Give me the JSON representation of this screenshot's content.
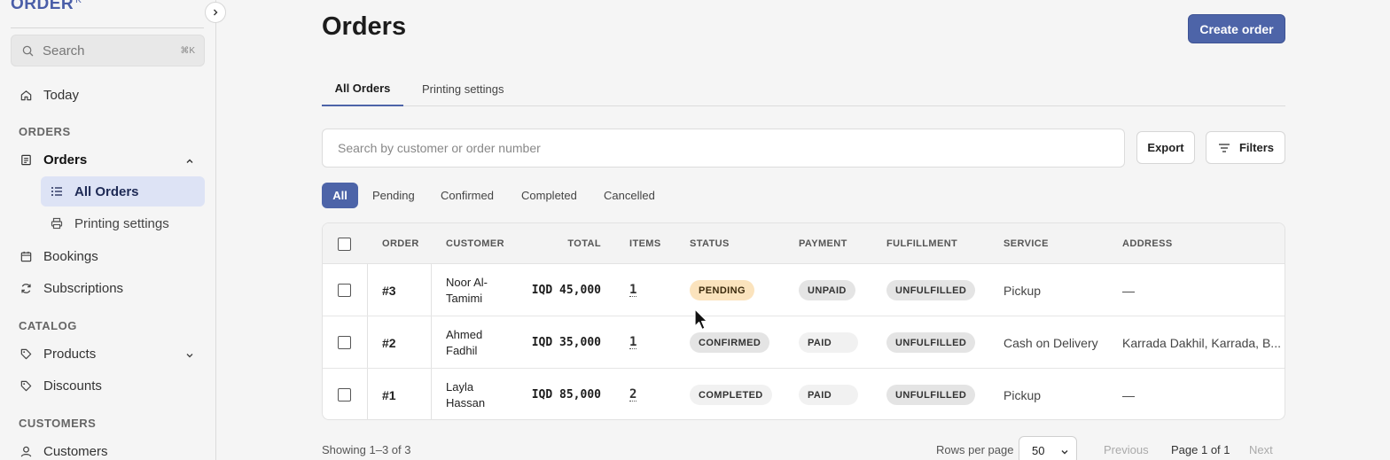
{
  "brand": {
    "logo_text": "ORDER",
    "logo_mark": "K"
  },
  "sidebar": {
    "search": {
      "placeholder": "Search",
      "shortcut": "⌘K"
    },
    "today": "Today",
    "sections": {
      "orders": "ORDERS",
      "catalog": "CATALOG",
      "customers": "CUSTOMERS"
    },
    "orders_label": "Orders",
    "orders_sub": [
      "All Orders",
      "Printing settings"
    ],
    "bookings": "Bookings",
    "subscriptions": "Subscriptions",
    "products": "Products",
    "discounts": "Discounts",
    "customers_item": "Customers"
  },
  "header": {
    "title": "Orders",
    "create_button": "Create order"
  },
  "tabs": [
    "All Orders",
    "Printing settings"
  ],
  "toolbar": {
    "search_placeholder": "Search by customer or order number",
    "export": "Export",
    "filters": "Filters"
  },
  "status_filters": [
    "All",
    "Pending",
    "Confirmed",
    "Completed",
    "Cancelled"
  ],
  "table": {
    "columns": [
      "ORDER",
      "CUSTOMER",
      "TOTAL",
      "ITEMS",
      "STATUS",
      "PAYMENT",
      "FULFILLMENT",
      "SERVICE",
      "ADDRESS"
    ],
    "rows": [
      {
        "order": "#3",
        "customer_line1": "Noor Al-",
        "customer_line2": "Tamimi",
        "total": "IQD 45,000",
        "items": "1",
        "status": "PENDING",
        "payment": "UNPAID",
        "fulfillment": "UNFULFILLED",
        "service": "Pickup",
        "address": "—"
      },
      {
        "order": "#2",
        "customer_line1": "Ahmed",
        "customer_line2": "Fadhil",
        "total": "IQD 35,000",
        "items": "1",
        "status": "CONFIRMED",
        "payment": "PAID",
        "fulfillment": "UNFULFILLED",
        "service": "Cash on Delivery",
        "address": "Karrada Dakhil, Karrada, B..."
      },
      {
        "order": "#1",
        "customer_line1": "Layla",
        "customer_line2": "Hassan",
        "total": "IQD 85,000",
        "items": "2",
        "status": "COMPLETED",
        "payment": "PAID",
        "fulfillment": "UNFULFILLED",
        "service": "Pickup",
        "address": "—"
      }
    ]
  },
  "footer": {
    "showing": "Showing 1–3 of 3",
    "rows_per_page_label": "Rows per page",
    "rows_per_page_value": "50",
    "previous": "Previous",
    "page_info": "Page 1 of 1",
    "next": "Next"
  },
  "colors": {
    "accent": "#4d64a8",
    "active_nav_bg": "#dde3f5",
    "pending_badge": "#fbe3bd"
  }
}
